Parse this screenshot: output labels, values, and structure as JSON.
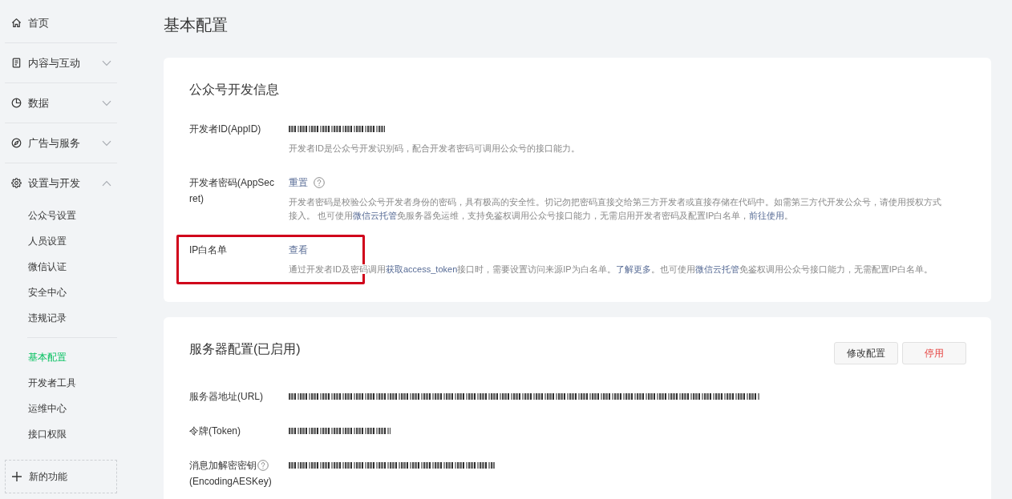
{
  "sidebar": {
    "groups": [
      {
        "label": "首页"
      },
      {
        "label": "内容与互动",
        "expanded": false
      },
      {
        "label": "数据",
        "expanded": false
      },
      {
        "label": "广告与服务",
        "expanded": false
      },
      {
        "label": "设置与开发",
        "expanded": true,
        "sections": [
          {
            "items": [
              {
                "label": "公众号设置",
                "selected": false
              },
              {
                "label": "人员设置",
                "selected": false
              },
              {
                "label": "微信认证",
                "selected": false
              },
              {
                "label": "安全中心",
                "selected": false
              },
              {
                "label": "违规记录",
                "selected": false
              }
            ]
          },
          {
            "items": [
              {
                "label": "基本配置",
                "selected": true
              },
              {
                "label": "开发者工具",
                "selected": false
              },
              {
                "label": "运维中心",
                "selected": false
              },
              {
                "label": "接口权限",
                "selected": false
              }
            ]
          }
        ]
      }
    ],
    "new_feature": {
      "label": "新的功能"
    }
  },
  "page_title": "基本配置",
  "cards": [
    {
      "title": "公众号开发信息",
      "rows": [
        {
          "label": "开发者ID(AppID)",
          "value": {
            "kind": "masked"
          },
          "description": [
            {
              "kind": "text",
              "text": "开发者ID是公众号开发识别码，配合开发者密码可调用公众号的接口能力。"
            }
          ],
          "highlighted": false
        },
        {
          "label": "开发者密码(AppSecret)",
          "value": {
            "kind": "link",
            "text": "重置",
            "help": true
          },
          "description": [
            {
              "kind": "text",
              "text": "开发者密码是校验公众号开发者身份的密码，具有极高的安全性。切记勿把密码直接交给第三方开发者或直接存储在代码中。如需第三方代开发公众号，请使用授权方式接入。 也可使用"
            },
            {
              "kind": "link",
              "text": "微信云托管"
            },
            {
              "kind": "text",
              "text": "免服务器免运维，支持免鉴权调用公众号接口能力，无需启用开发者密码及配置IP白名单，"
            },
            {
              "kind": "link",
              "text": "前往使用"
            },
            {
              "kind": "text",
              "text": "。"
            }
          ],
          "highlighted": false
        },
        {
          "label": "IP白名单",
          "value": {
            "kind": "link",
            "text": "查看"
          },
          "description": [
            {
              "kind": "text",
              "text": "通过开发者ID及密码调用"
            },
            {
              "kind": "link",
              "text": "获取access_token"
            },
            {
              "kind": "text",
              "text": "接口时，需要设置访问来源IP为白名单。"
            },
            {
              "kind": "link",
              "text": "了解更多"
            },
            {
              "kind": "text",
              "text": "。也可使用"
            },
            {
              "kind": "link",
              "text": "微信云托管"
            },
            {
              "kind": "text",
              "text": "免鉴权调用公众号接口能力，无需配置IP白名单。"
            }
          ],
          "highlighted": true
        }
      ]
    },
    {
      "title": "服务器配置(已启用)",
      "buttons": [
        {
          "label": "修改配置",
          "kind": "default"
        },
        {
          "label": "停用",
          "kind": "danger"
        }
      ],
      "rows": [
        {
          "label": "服务器地址(URL)",
          "value": {
            "kind": "masked"
          },
          "highlighted": false
        },
        {
          "label": "令牌(Token)",
          "value": {
            "kind": "masked"
          },
          "highlighted": false
        },
        {
          "label": "消息加解密密钥",
          "label_help": true,
          "label_note": "(EncodingAESKey)",
          "value": {
            "kind": "masked"
          },
          "highlighted": false
        }
      ]
    }
  ]
}
